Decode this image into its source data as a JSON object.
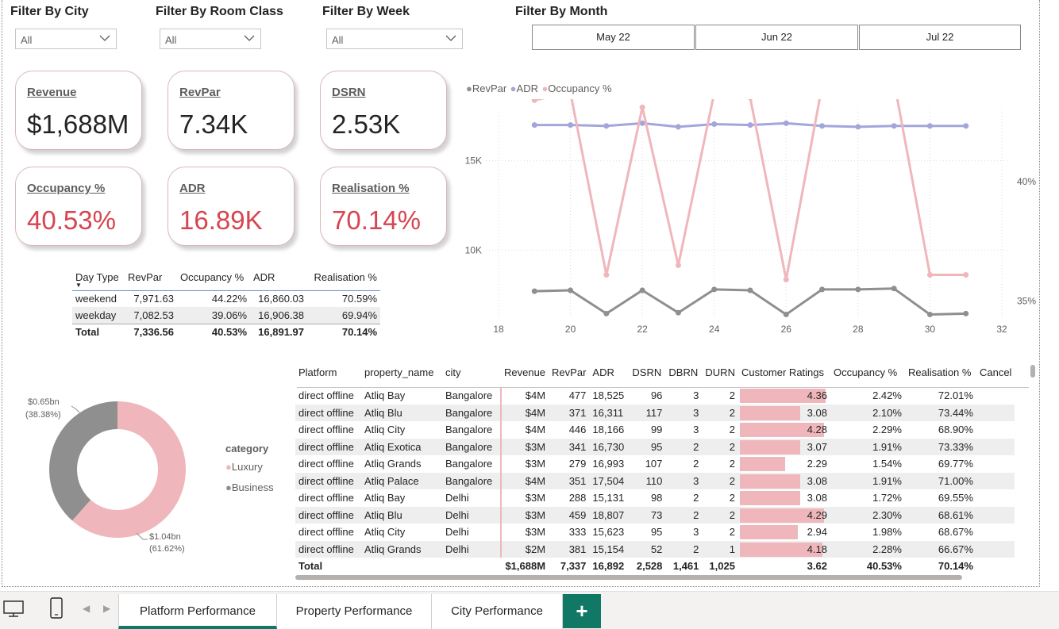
{
  "filters": {
    "city": {
      "title": "Filter By City",
      "value": "All"
    },
    "room_class": {
      "title": "Filter By Room Class",
      "value": "All"
    },
    "week": {
      "title": "Filter By Week",
      "value": "All"
    },
    "month": {
      "title": "Filter By Month",
      "options": [
        "May 22",
        "Jun 22",
        "Jul 22"
      ]
    }
  },
  "kpis": [
    {
      "label": "Revenue",
      "value": "$1,688M",
      "color": "#252423"
    },
    {
      "label": "RevPar",
      "value": "7.34K",
      "color": "#252423"
    },
    {
      "label": "DSRN",
      "value": "2.53K",
      "color": "#252423"
    },
    {
      "label": "Occupancy %",
      "value": "40.53%",
      "color": "#d64550"
    },
    {
      "label": "ADR",
      "value": "16.89K",
      "color": "#d64550"
    },
    {
      "label": "Realisation %",
      "value": "70.14%",
      "color": "#d64550"
    }
  ],
  "day_type_table": {
    "headers": [
      "Day Type",
      "RevPar",
      "Occupancy %",
      "ADR",
      "Realisation %"
    ],
    "rows": [
      [
        "weekend",
        "7,971.63",
        "44.22%",
        "16,860.03",
        "70.59%"
      ],
      [
        "weekday",
        "7,082.53",
        "39.06%",
        "16,906.38",
        "69.94%"
      ]
    ],
    "total": [
      "Total",
      "7,336.56",
      "40.53%",
      "16,891.97",
      "70.14%"
    ]
  },
  "chart_data": [
    {
      "type": "line",
      "legend": [
        "RevPar",
        "ADR",
        "Occupancy %"
      ],
      "colors": {
        "RevPar": "#8f8f8f",
        "ADR": "#a3a6db",
        "Occupancy %": "#efb7bb"
      },
      "x_ticks": [
        "18",
        "20",
        "22",
        "24",
        "26",
        "28",
        "30",
        "32"
      ],
      "y_left_ticks": [
        "15K",
        "10K"
      ],
      "y_right_ticks": [
        "40%",
        "35%"
      ],
      "xlim": [
        18,
        32
      ],
      "ylim_left": [
        5000,
        20000
      ],
      "ylim_right": [
        33.4,
        44.6
      ],
      "x": [
        19,
        20,
        21,
        22,
        23,
        24,
        25,
        26,
        27,
        28,
        29,
        30,
        31
      ],
      "series": [
        {
          "name": "RevPar",
          "axis": "left",
          "values": [
            7700,
            7750,
            6450,
            7750,
            6500,
            7800,
            7750,
            6400,
            7800,
            7800,
            7850,
            6400,
            6450
          ]
        },
        {
          "name": "ADR",
          "axis": "left",
          "values": [
            17000,
            17000,
            16950,
            17100,
            16900,
            17050,
            17000,
            17100,
            16950,
            16900,
            16950,
            16950,
            16950
          ]
        },
        {
          "name": "Occupancy %",
          "axis": "right",
          "values": [
            43.4,
            43.7,
            36.1,
            43.1,
            36.5,
            43.7,
            43.5,
            35.9,
            44.0,
            44.1,
            44.2,
            36.1,
            36.1
          ]
        }
      ]
    },
    {
      "type": "pie",
      "legend_title": "category",
      "legend": [
        "Luxury",
        "Business"
      ],
      "slices": [
        {
          "name": "Luxury",
          "value": 1.04,
          "label": "$1.04bn",
          "pct_label": "(61.62%)",
          "color": "#efb7bb"
        },
        {
          "name": "Business",
          "value": 0.65,
          "label": "$0.65bn",
          "pct_label": "(38.38%)",
          "color": "#8f8f8f"
        }
      ]
    }
  ],
  "platform_table": {
    "headers": [
      "Platform",
      "property_name",
      "city",
      "Revenue",
      "RevPar",
      "ADR",
      "DSRN",
      "DBRN",
      "DURN",
      "Customer Ratings",
      "Occupancy %",
      "Realisation %",
      "Cancel"
    ],
    "rows": [
      [
        "direct offline",
        "Atliq Bay",
        "Bangalore",
        "$4M",
        "477",
        "18,525",
        "96",
        "3",
        "2",
        "4.36",
        "2.42%",
        "72.01%"
      ],
      [
        "direct offline",
        "Atliq Blu",
        "Bangalore",
        "$4M",
        "371",
        "16,311",
        "117",
        "3",
        "2",
        "3.08",
        "2.10%",
        "73.44%"
      ],
      [
        "direct offline",
        "Atliq City",
        "Bangalore",
        "$4M",
        "446",
        "18,166",
        "99",
        "3",
        "2",
        "4.28",
        "2.29%",
        "68.90%"
      ],
      [
        "direct offline",
        "Atliq Exotica",
        "Bangalore",
        "$3M",
        "341",
        "16,730",
        "95",
        "2",
        "2",
        "3.07",
        "1.91%",
        "73.33%"
      ],
      [
        "direct offline",
        "Atliq Grands",
        "Bangalore",
        "$3M",
        "279",
        "16,993",
        "107",
        "2",
        "2",
        "2.29",
        "1.54%",
        "69.77%"
      ],
      [
        "direct offline",
        "Atliq Palace",
        "Bangalore",
        "$4M",
        "351",
        "17,504",
        "110",
        "3",
        "2",
        "3.08",
        "1.91%",
        "71.00%"
      ],
      [
        "direct offline",
        "Atliq Bay",
        "Delhi",
        "$3M",
        "288",
        "15,131",
        "98",
        "2",
        "2",
        "3.08",
        "1.72%",
        "69.55%"
      ],
      [
        "direct offline",
        "Atliq Blu",
        "Delhi",
        "$3M",
        "459",
        "18,807",
        "73",
        "2",
        "2",
        "4.29",
        "2.30%",
        "68.61%"
      ],
      [
        "direct offline",
        "Atliq City",
        "Delhi",
        "$3M",
        "333",
        "15,623",
        "95",
        "3",
        "2",
        "2.94",
        "1.98%",
        "68.67%"
      ],
      [
        "direct offline",
        "Atliq Grands",
        "Delhi",
        "$2M",
        "381",
        "15,154",
        "52",
        "2",
        "1",
        "4.18",
        "2.28%",
        "66.67%"
      ]
    ],
    "total": [
      "Total",
      "",
      "",
      "$1,688M",
      "7,337",
      "16,892",
      "2,528",
      "1,461",
      "1,025",
      "3.62",
      "40.53%",
      "70.14%"
    ]
  },
  "tabs": [
    "Platform Performance",
    "Property Performance",
    "City Performance"
  ],
  "active_tab": "Platform Performance",
  "add_tab_label": "+",
  "icons": {
    "desktop": "desktop-view-icon",
    "mobile": "mobile-view-icon",
    "prev": "prev-page-icon",
    "next": "next-page-icon"
  }
}
